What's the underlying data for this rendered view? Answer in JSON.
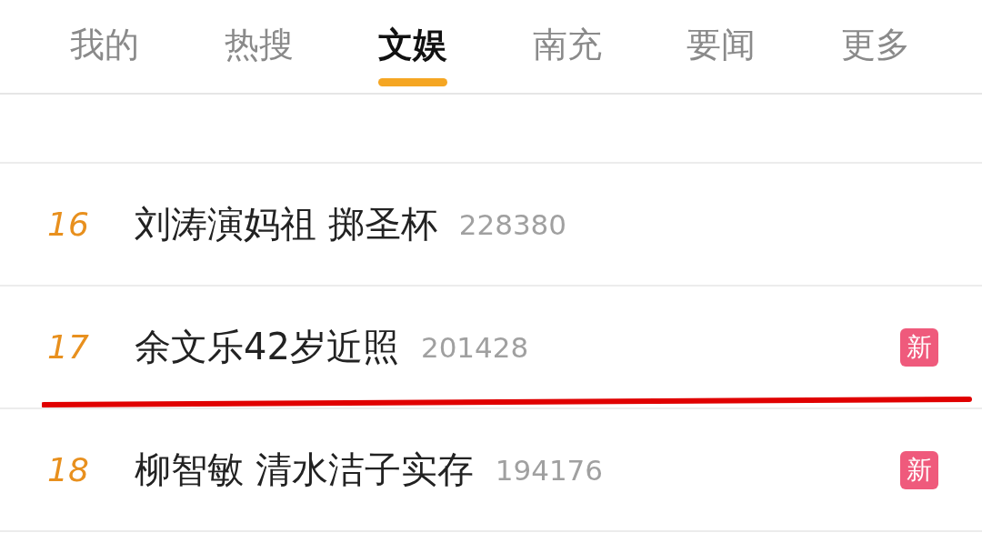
{
  "tabs": [
    {
      "label": "我的",
      "selected": false
    },
    {
      "label": "热搜",
      "selected": false
    },
    {
      "label": "文娱",
      "selected": true
    },
    {
      "label": "南充",
      "selected": false
    },
    {
      "label": "要闻",
      "selected": false
    },
    {
      "label": "更多",
      "selected": false
    }
  ],
  "rows": [
    {
      "rank": "16",
      "title": "刘涛演妈祖 掷圣杯",
      "count": "228380"
    },
    {
      "rank": "17",
      "title": "余文乐42岁近照",
      "count": "201428",
      "badge": "新"
    },
    {
      "rank": "18",
      "title": "柳智敏 清水洁子实存",
      "count": "194176",
      "badge": "新"
    }
  ]
}
